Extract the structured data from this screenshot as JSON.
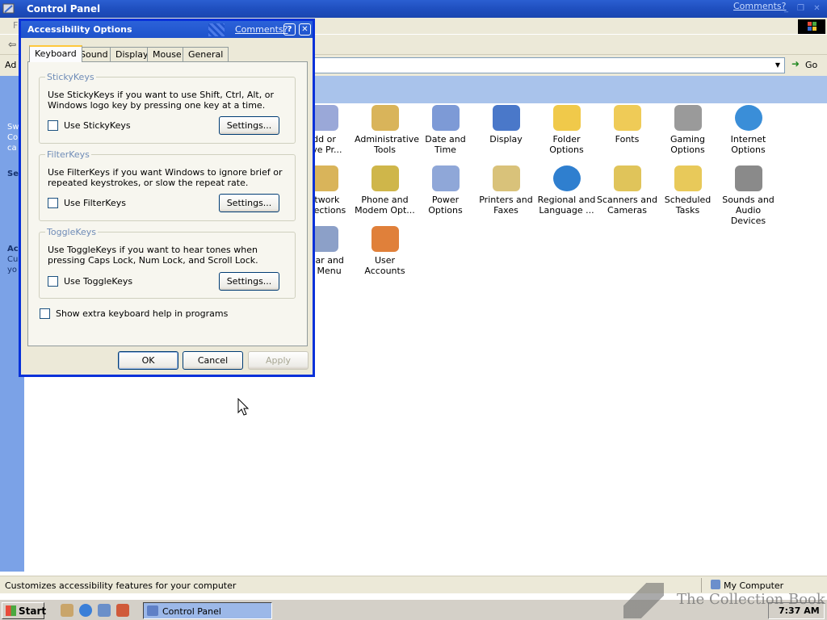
{
  "control_panel": {
    "title": "Control Panel",
    "comments_link": "Comments?",
    "menu_letter": "F",
    "address_label": "Ad",
    "go_label": "Go",
    "left_panel": [
      "Sw",
      "Co",
      "ca",
      "Se",
      "Ac",
      "Cu",
      "yo"
    ],
    "icons": [
      {
        "label": "dd or\nove Pr...",
        "icon": "add-remove-programs-icon",
        "color": "#9aa8d8"
      },
      {
        "label": "Administrative\nTools",
        "icon": "administrative-tools-icon",
        "color": "#d9b45a"
      },
      {
        "label": "Date and Time",
        "icon": "date-time-icon",
        "color": "#7d9ad6"
      },
      {
        "label": "Display",
        "icon": "display-icon",
        "color": "#4a78c9"
      },
      {
        "label": "Folder Options",
        "icon": "folder-options-icon",
        "color": "#f0c94a"
      },
      {
        "label": "Fonts",
        "icon": "fonts-icon",
        "color": "#efcb57"
      },
      {
        "label": "Gaming\nOptions",
        "icon": "gaming-options-icon",
        "color": "#9a9a9a"
      },
      {
        "label": "Internet\nOptions",
        "icon": "internet-options-icon",
        "color": "#3a8ed8"
      },
      {
        "label": "etwork\nnnections",
        "icon": "network-connections-icon",
        "color": "#d9b45a"
      },
      {
        "label": "Phone and\nModem Opt...",
        "icon": "phone-modem-icon",
        "color": "#cfb64a"
      },
      {
        "label": "Power Options",
        "icon": "power-options-icon",
        "color": "#8fa7d8"
      },
      {
        "label": "Printers and\nFaxes",
        "icon": "printers-faxes-icon",
        "color": "#d9c27a"
      },
      {
        "label": "Regional and\nLanguage ...",
        "icon": "regional-language-icon",
        "color": "#2f7fcf"
      },
      {
        "label": "Scanners and\nCameras",
        "icon": "scanners-cameras-icon",
        "color": "#e0c45a"
      },
      {
        "label": "Scheduled\nTasks",
        "icon": "scheduled-tasks-icon",
        "color": "#e8c95a"
      },
      {
        "label": "Sounds and\nAudio Devices",
        "icon": "sounds-audio-icon",
        "color": "#8a8a8a"
      },
      {
        "label": "kbar and\nrt Menu",
        "icon": "taskbar-start-menu-icon",
        "color": "#8ca0c8"
      },
      {
        "label": "User Accounts",
        "icon": "user-accounts-icon",
        "color": "#e0803a"
      }
    ]
  },
  "dialog": {
    "title": "Accessibility Options",
    "comments_link": "Comments?",
    "help": "?",
    "close": "✕",
    "tabs": [
      "Keyboard",
      "Sound",
      "Display",
      "Mouse",
      "General"
    ],
    "active_tab": "Keyboard",
    "groups": [
      {
        "label": "StickyKeys",
        "description": "Use StickyKeys if you want to use Shift, Ctrl, Alt, or Windows logo key by pressing one key at a time.",
        "checkbox": "Use StickyKeys",
        "checked": false,
        "button": "Settings..."
      },
      {
        "label": "FilterKeys",
        "description": "Use FilterKeys if you want Windows to ignore brief or repeated keystrokes, or slow the repeat rate.",
        "checkbox": "Use FilterKeys",
        "checked": false,
        "button": "Settings..."
      },
      {
        "label": "ToggleKeys",
        "description": "Use ToggleKeys if you want to hear tones when pressing Caps Lock, Num Lock, and Scroll Lock.",
        "checkbox": "Use ToggleKeys",
        "checked": false,
        "button": "Settings..."
      }
    ],
    "extra_help_checkbox": "Show extra keyboard help in programs",
    "ok": "OK",
    "cancel": "Cancel",
    "apply": "Apply"
  },
  "status_bar": {
    "text": "Customizes accessibility features for your computer",
    "zone": "My Computer"
  },
  "taskbar": {
    "start": "Start",
    "task": "Control Panel",
    "clock": "7:37 AM"
  },
  "watermark": "The Collection Book",
  "colors": {
    "title_blue": "#1f4fbf",
    "dialog_border": "#0831d9",
    "face": "#ece9d8",
    "tab_highlight": "#ffc83c",
    "group_label": "#6f8cb7"
  }
}
